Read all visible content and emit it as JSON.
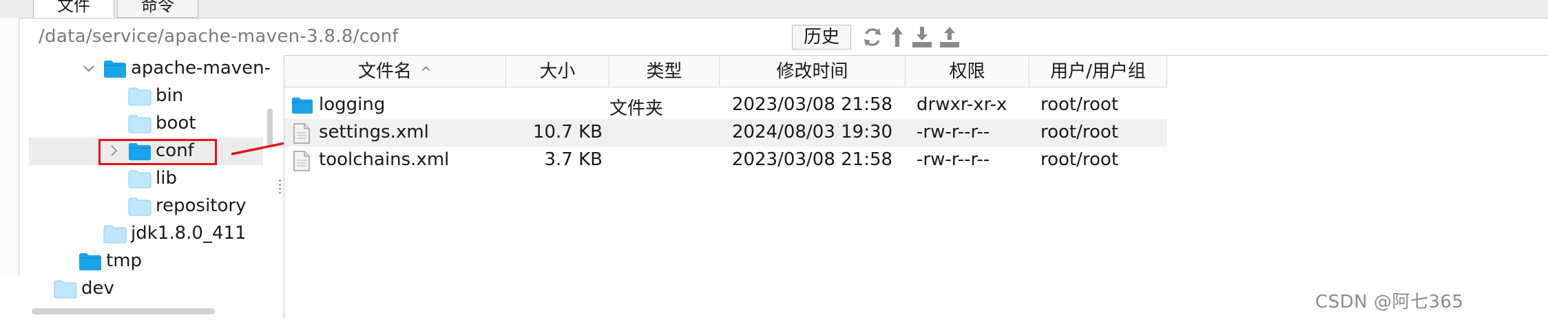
{
  "tabs": [
    {
      "label": "文件"
    },
    {
      "label": "命令"
    }
  ],
  "toolbar": {
    "path": "/data/service/apache-maven-3.8.8/conf",
    "history_label": "历史",
    "icons": [
      "refresh-icon",
      "up-icon",
      "download-icon",
      "upload-icon"
    ]
  },
  "tree": {
    "items": [
      {
        "label": "apache-maven-",
        "level": 2,
        "expanded": true
      },
      {
        "label": "bin",
        "level": 3
      },
      {
        "label": "boot",
        "level": 3
      },
      {
        "label": "conf",
        "level": 3,
        "selected": true,
        "collapsed": true
      },
      {
        "label": "lib",
        "level": 3
      },
      {
        "label": "repository",
        "level": 3
      },
      {
        "label": "jdk1.8.0_411",
        "level": 2
      },
      {
        "label": "tmp",
        "level": 1
      },
      {
        "label": "dev",
        "level": 0
      }
    ]
  },
  "file_list": {
    "headers": {
      "name": "文件名",
      "size": "大小",
      "type": "类型",
      "modified": "修改时间",
      "permissions": "权限",
      "owner": "用户/用户组"
    },
    "sort_indicator": "^",
    "rows": [
      {
        "icon": "folder-icon",
        "name": "logging",
        "size": "",
        "type": "文件夹",
        "modified": "2023/03/08 21:58",
        "permissions": "drwxr-xr-x",
        "owner": "root/root"
      },
      {
        "icon": "file-icon",
        "name": "settings.xml",
        "size": "10.7 KB",
        "type": "",
        "modified": "2024/08/03 19:30",
        "permissions": "-rw-r--r--",
        "owner": "root/root"
      },
      {
        "icon": "file-icon",
        "name": "toolchains.xml",
        "size": "3.7 KB",
        "type": "",
        "modified": "2023/03/08 21:58",
        "permissions": "-rw-r--r--",
        "owner": "root/root"
      }
    ]
  },
  "annotation": {
    "color": "#e0141e"
  },
  "watermark": "CSDN @阿七365",
  "colors": {
    "folder": "#1aa3e8",
    "folder_light": "#bfe6fb"
  }
}
